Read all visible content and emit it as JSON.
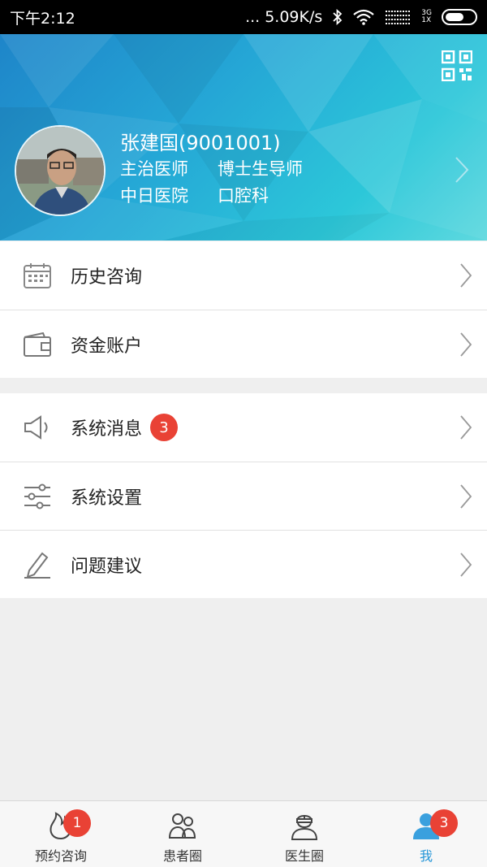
{
  "status_bar": {
    "time": "下午2:12",
    "network_speed": "... 5.09K/s",
    "network_type_top": "3G",
    "network_type_bottom": "1X"
  },
  "profile": {
    "name": "张建国(9001001)",
    "title": "主治医师",
    "role": "博士生导师",
    "hospital": "中日医院",
    "department": "口腔科"
  },
  "menu": {
    "history_label": "历史咨询",
    "account_label": "资金账户",
    "messages_label": "系统消息",
    "messages_badge": "3",
    "settings_label": "系统设置",
    "feedback_label": "问题建议"
  },
  "tabbar": {
    "tab1_label": "预约咨询",
    "tab1_badge": "1",
    "tab2_label": "患者圈",
    "tab3_label": "医生圈",
    "tab4_label": "我",
    "tab4_badge": "3"
  },
  "colors": {
    "accent": "#2596d8",
    "badge": "#e94235",
    "header_start": "#1e85c9",
    "header_end": "#5fd9df"
  }
}
